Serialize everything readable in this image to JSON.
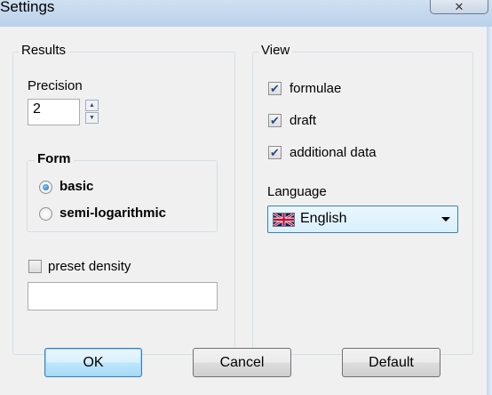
{
  "window": {
    "title": "Settings",
    "close_glyph": "✕"
  },
  "results": {
    "label": "Results",
    "precision_label": "Precision",
    "precision_value": "2",
    "form": {
      "label": "Form",
      "options": [
        {
          "label": "basic",
          "selected": true
        },
        {
          "label": "semi-logarithmic",
          "selected": false
        }
      ]
    },
    "preset_density": {
      "label": "preset density",
      "checked": false,
      "value": ""
    }
  },
  "view": {
    "label": "View",
    "options": [
      {
        "label": "formulae",
        "checked": true
      },
      {
        "label": "draft",
        "checked": true
      },
      {
        "label": "additional data",
        "checked": true
      }
    ],
    "language_label": "Language",
    "language_value": "English",
    "language_icon": "uk-flag-icon"
  },
  "buttons": {
    "ok": "OK",
    "cancel": "Cancel",
    "default": "Default"
  },
  "colors": {
    "accent": "#3c7fb1",
    "checkmark": "#2b4a8a"
  }
}
